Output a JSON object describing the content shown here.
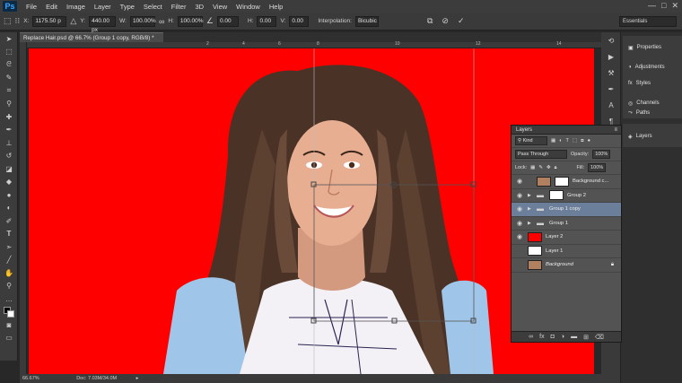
{
  "app": {
    "logo": "Ps",
    "window_controls": [
      "—",
      "□",
      "✕"
    ]
  },
  "menu": [
    "File",
    "Edit",
    "Image",
    "Layer",
    "Type",
    "Select",
    "Filter",
    "3D",
    "View",
    "Window",
    "Help"
  ],
  "options": {
    "x_label": "X:",
    "x_value": "1175.50 p",
    "y_label": "Y:",
    "y_value": "440.00 px",
    "w_label": "W:",
    "w_value": "100.00%",
    "h_label": "H:",
    "h_value": "100.00%",
    "angle_value": "0.00",
    "hskew_label": "H:",
    "hskew_value": "0.00",
    "vskew_label": "V:",
    "vskew_value": "0.00",
    "interp_label": "Interpolation:",
    "interp_value": "Bicubic",
    "workspace": "Essentials"
  },
  "document": {
    "tab_title": "Replace Hair.psd @ 66.7% (Group 1 copy, RGB/8) *",
    "zoom": "66.67%",
    "doc_size": "Doc: 7.03M/34.0M",
    "canvas_color": "#ff0000",
    "ruler_labels": [
      "2",
      "4",
      "6",
      "8",
      "10",
      "12",
      "14"
    ]
  },
  "dock": {
    "panels": [
      {
        "icon": "properties-icon",
        "label": "Properties"
      },
      {
        "icon": "adjustments-icon",
        "label": "Adjustments"
      },
      {
        "icon": "styles-icon",
        "label": "Styles"
      },
      {
        "icon": "channels-icon",
        "label": "Channels"
      },
      {
        "icon": "paths-icon",
        "label": "Paths"
      }
    ],
    "layers_tab": "Layers"
  },
  "layers": {
    "title": "Layers",
    "filter_label": "Kind",
    "blend_mode": "Pass Through",
    "opacity_label": "Opacity:",
    "opacity_value": "100%",
    "lock_label": "Lock:",
    "fill_label": "Fill:",
    "fill_value": "100%",
    "items": [
      {
        "name": "Background c...",
        "type": "layer",
        "visible": true,
        "selected": false,
        "thumb": "#b08060"
      },
      {
        "name": "Group 2",
        "type": "group",
        "visible": true,
        "selected": false,
        "thumb": "#ffffff"
      },
      {
        "name": "Group 1 copy",
        "type": "group",
        "visible": true,
        "selected": true,
        "thumb": ""
      },
      {
        "name": "Group 1",
        "type": "group",
        "visible": true,
        "selected": false,
        "thumb": ""
      },
      {
        "name": "Layer 2",
        "type": "layer",
        "visible": true,
        "selected": false,
        "thumb": "#ff0000"
      },
      {
        "name": "Layer 1",
        "type": "layer",
        "visible": false,
        "selected": false,
        "thumb": "#ffffff"
      },
      {
        "name": "Background",
        "type": "layer",
        "visible": false,
        "selected": false,
        "thumb": "#b08060",
        "italic": true
      }
    ],
    "footer_icons": [
      "link-icon",
      "fx-icon",
      "mask-icon",
      "adjustment-icon",
      "folder-icon",
      "new-layer-icon",
      "trash-icon"
    ]
  }
}
